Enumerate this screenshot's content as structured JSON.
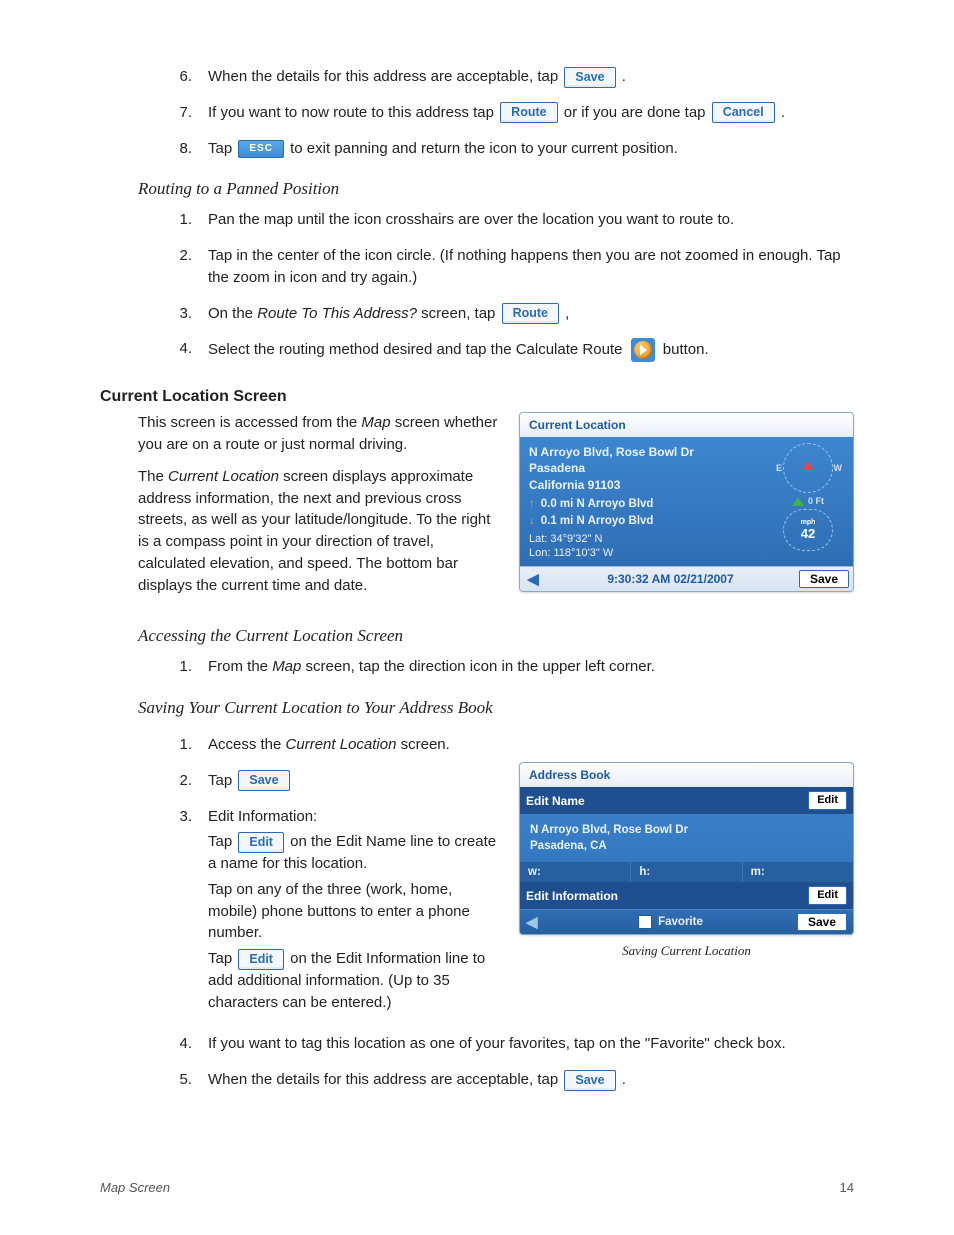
{
  "steps_top": {
    "s6_a": "When the details for this address are acceptable, tap ",
    "s6_b": " .",
    "s7_a": "If you want to now route to this address tap ",
    "s7_b": "  or if you are done tap ",
    "s7_c": " .",
    "s8_a": "Tap  ",
    "s8_b": "  to exit panning and return the icon to your current position."
  },
  "buttons": {
    "save": "Save",
    "route": "Route",
    "cancel": "Cancel",
    "esc": "ESC",
    "edit": "Edit"
  },
  "sections": {
    "routing_heading": "Routing to a Panned Position",
    "current_loc_heading": "Current Location Screen",
    "accessing_heading": "Accessing the Current Location Screen",
    "saving_heading": "Saving Your Current Location to Your Address Book"
  },
  "routing_steps": {
    "r1": "Pan the map until the icon crosshairs are over the location you want to route to.",
    "r2": "Tap in the center of the icon circle.  (If nothing happens then you are not zoomed in enough.  Tap the zoom in icon and try again.)",
    "r3_a": "On the ",
    "r3_b": "Route To This Address?",
    "r3_c": " screen, tap ",
    "r3_d": " ,",
    "r4_a": "Select the routing method desired and tap the Calculate Route ",
    "r4_b": "  button."
  },
  "curloc_text": {
    "p1_a": "This screen is accessed from the ",
    "p1_b": "Map",
    "p1_c": " screen whether you are on a route or just normal driving.",
    "p2_a": "The ",
    "p2_b": "Current Location",
    "p2_c": " screen displays approximate address information, the next and previous cross streets, as well as your latitude/longitude.  To the right is a compass point in your direction of travel, calculated elevation, and speed.  The bottom bar displays the current time and date."
  },
  "current_location_mock": {
    "title": "Current Location",
    "address_line1": "N Arroyo Blvd, Rose Bowl Dr",
    "address_line2": "Pasadena",
    "address_line3": "California 91103",
    "next": "0.0 mi N Arroyo Blvd",
    "prev": "0.1 mi N Arroyo Blvd",
    "lat": "Lat:   34°9'32\"   N",
    "lon": "Lon: 118°10'3\"   W",
    "compass_e": "E",
    "compass_w": "W",
    "elevation": "0 Ft",
    "speed_unit": "mph",
    "speed": "42",
    "datetime": "9:30:32 AM  02/21/2007",
    "save": "Save"
  },
  "accessing_steps": {
    "a1_a": "From the ",
    "a1_b": "Map",
    "a1_c": " screen, tap the direction icon in the upper left corner."
  },
  "saving_steps": {
    "s1_a": "Access the ",
    "s1_b": "Current Location",
    "s1_c": " screen.",
    "s2": "Tap ",
    "s3_label": "Edit Information:",
    "s3_a": "Tap ",
    "s3_b": " on the Edit Name line to create a name for this location.",
    "s3_c": "Tap on any of the three (work, home, mobile) phone buttons to enter a phone number.",
    "s3_d": "Tap ",
    "s3_e": " on the Edit Information line to add additional information.  (Up to 35 characters can be entered.)",
    "s4": "If you want to tag this location as one of your favorites, tap on the \"Favorite\" check box.",
    "s5_a": "When the details for this address are acceptable, tap ",
    "s5_b": " ."
  },
  "address_book_mock": {
    "title": "Address Book",
    "edit_name": "Edit Name",
    "addr_line1": "N Arroyo Blvd, Rose Bowl Dr",
    "addr_line2": "Pasadena, CA",
    "w": "w:",
    "h": "h:",
    "m": "m:",
    "edit_info": "Edit Information",
    "favorite": "Favorite",
    "edit": "Edit",
    "save": "Save",
    "caption": "Saving Current Location"
  },
  "footer": {
    "left": "Map Screen",
    "right": "14"
  }
}
